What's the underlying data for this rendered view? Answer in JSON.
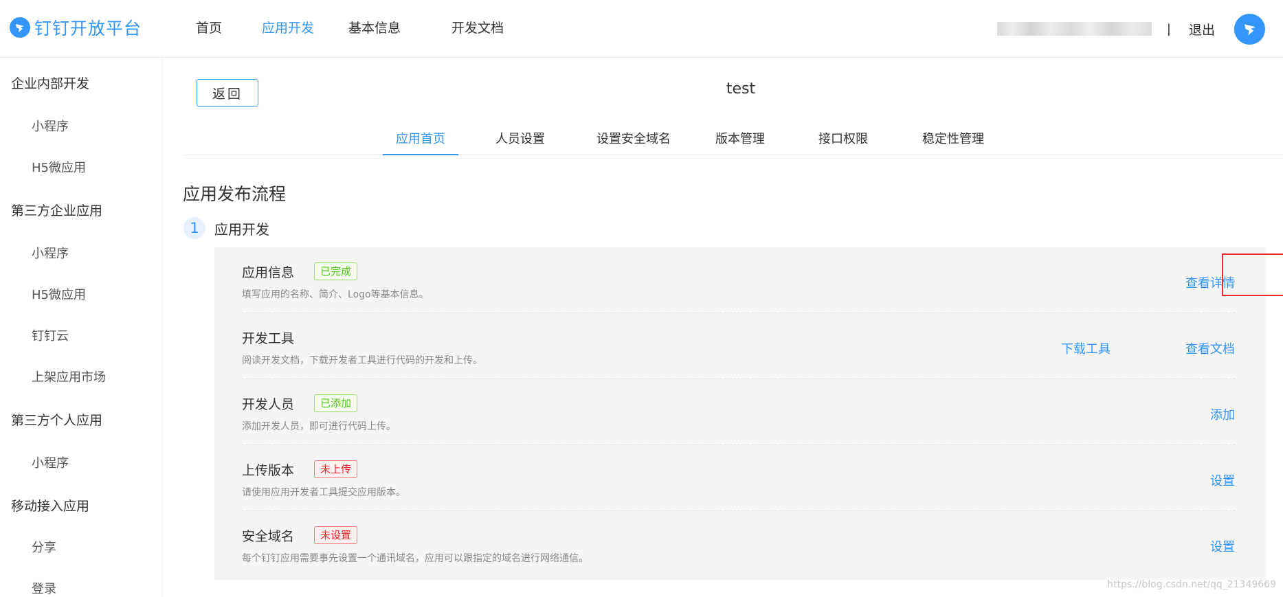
{
  "header": {
    "logo_text": "钉钉开放平台",
    "nav": [
      "首页",
      "应用开发",
      "基本信息",
      "开发文档"
    ],
    "active_nav": "应用开发",
    "separator": "|",
    "logout": "退出"
  },
  "sidebar": {
    "groups": [
      {
        "title": "企业内部开发",
        "items": [
          "小程序",
          "H5微应用"
        ]
      },
      {
        "title": "第三方企业应用",
        "items": [
          "小程序",
          "H5微应用",
          "钉钉云",
          "上架应用市场"
        ]
      },
      {
        "title": "第三方个人应用",
        "items": [
          "小程序"
        ]
      },
      {
        "title": "移动接入应用",
        "items": [
          "分享",
          "登录"
        ]
      }
    ]
  },
  "main": {
    "back_button": "返回",
    "app_title": "test",
    "tabs": [
      "应用首页",
      "人员设置",
      "设置安全域名",
      "版本管理",
      "接口权限",
      "稳定性管理"
    ],
    "active_tab": "应用首页",
    "section_title": "应用发布流程",
    "step": {
      "number": "1",
      "label": "应用开发"
    },
    "rows": [
      {
        "title": "应用信息",
        "badge": "已完成",
        "badge_type": "done",
        "desc": "填写应用的名称、简介、Logo等基本信息。",
        "actions": [
          "查看详情"
        ]
      },
      {
        "title": "开发工具",
        "badge": "",
        "badge_type": "",
        "desc": "阅读开发文档，下载开发者工具进行代码的开发和上传。",
        "actions": [
          "下载工具",
          "查看文档"
        ]
      },
      {
        "title": "开发人员",
        "badge": "已添加",
        "badge_type": "done",
        "desc": "添加开发人员，即可进行代码上传。",
        "actions": [
          "添加"
        ]
      },
      {
        "title": "上传版本",
        "badge": "未上传",
        "badge_type": "todo",
        "desc": "请使用应用开发者工具提交应用版本。",
        "actions": [
          "设置"
        ]
      },
      {
        "title": "安全域名",
        "badge": "未设置",
        "badge_type": "todo",
        "desc": "每个钉钉应用需要事先设置一个通讯域名，应用可以跟指定的域名进行网络通信。",
        "actions": [
          "设置"
        ]
      }
    ]
  },
  "watermark": "https://blog.csdn.net/qq_21349669",
  "colors": {
    "accent": "#3296fa",
    "done": "#52c41a",
    "todo": "#f5222d",
    "highlight": "#e62e2e"
  }
}
